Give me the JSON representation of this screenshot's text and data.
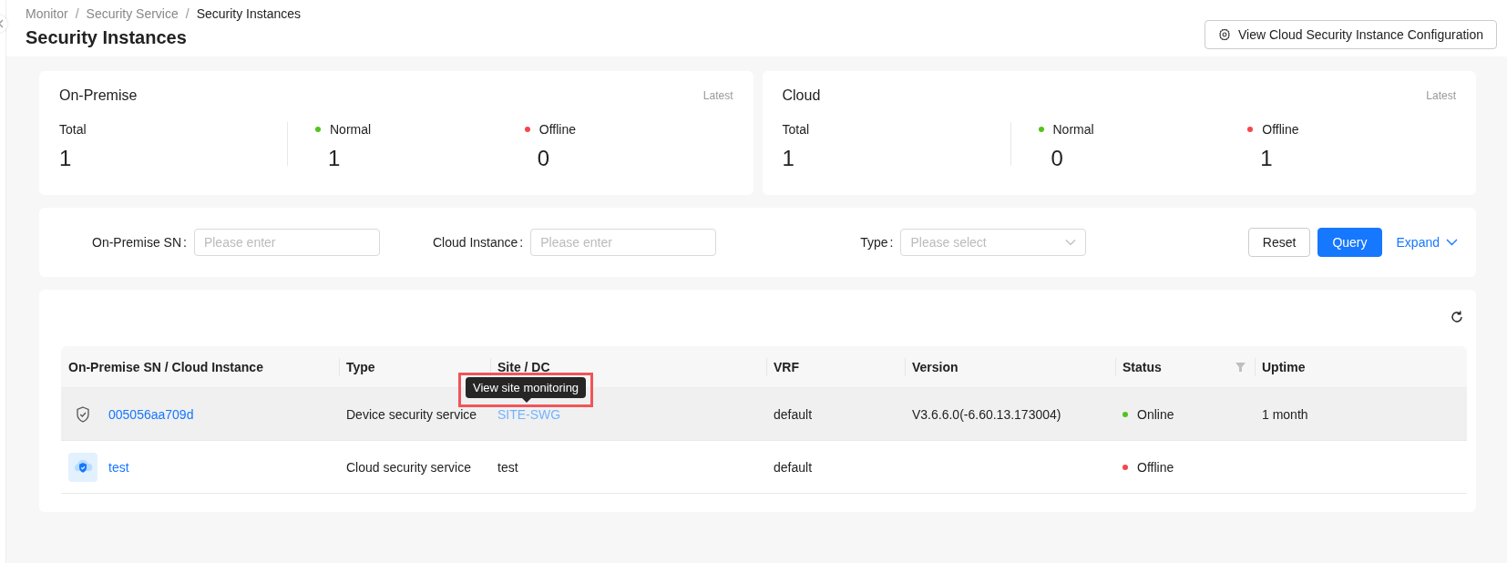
{
  "breadcrumb": [
    {
      "label": "Monitor",
      "current": false
    },
    {
      "label": "Security Service",
      "current": false
    },
    {
      "label": "Security Instances",
      "current": true
    }
  ],
  "breadcrumb_separator": "/",
  "title": "Security Instances",
  "config_button": {
    "label": "View Cloud Security Instance Configuration"
  },
  "stat_cards": [
    {
      "title": "On-Premise",
      "note": "Latest",
      "metrics": [
        {
          "label": "Total",
          "value": "1"
        },
        {
          "label": "Normal",
          "value": "1",
          "color": "#52c41a"
        },
        {
          "label": "Offline",
          "value": "0",
          "color": "#f5464b"
        }
      ]
    },
    {
      "title": "Cloud",
      "note": "Latest",
      "metrics": [
        {
          "label": "Total",
          "value": "1"
        },
        {
          "label": "Normal",
          "value": "0",
          "color": "#52c41a"
        },
        {
          "label": "Offline",
          "value": "1",
          "color": "#f5464b"
        }
      ]
    }
  ],
  "filters": [
    {
      "kind": "input",
      "label": "On-Premise SN",
      "colon": ":",
      "placeholder": "Please enter"
    },
    {
      "kind": "input",
      "label": "Cloud Instance",
      "colon": ":",
      "placeholder": "Please enter"
    },
    {
      "kind": "select",
      "label": "Type",
      "colon": ":",
      "placeholder": "Please select"
    }
  ],
  "filter_actions": [
    {
      "kind": "default",
      "label": "Reset"
    },
    {
      "kind": "primary",
      "label": "Query"
    },
    {
      "kind": "link",
      "label": "Expand"
    }
  ],
  "table": {
    "columns": [
      {
        "label": "On-Premise SN / Cloud Instance",
        "filterable": false
      },
      {
        "label": "Type",
        "filterable": false
      },
      {
        "label": "Site / DC",
        "filterable": false
      },
      {
        "label": "VRF",
        "filterable": false
      },
      {
        "label": "Version",
        "filterable": false
      },
      {
        "label": "Status",
        "filterable": true
      },
      {
        "label": "Uptime",
        "filterable": false
      }
    ],
    "rows": [
      {
        "hovered": true,
        "kind": "device",
        "name": "005056aa709d",
        "type": "Device security service",
        "site": "SITE-SWG",
        "site_link": true,
        "vrf": "default",
        "version": "V3.6.6.0(-6.60.13.173004)",
        "status": "Online",
        "color": "#52c41a",
        "uptime": "1 month"
      },
      {
        "hovered": false,
        "kind": "cloud",
        "name": "test",
        "type": "Cloud security service",
        "site": "test",
        "site_link": false,
        "vrf": "default",
        "status": "Offline",
        "color": "#f5464b"
      }
    ],
    "tooltip": {
      "text": "View site monitoring",
      "framed": true
    }
  }
}
